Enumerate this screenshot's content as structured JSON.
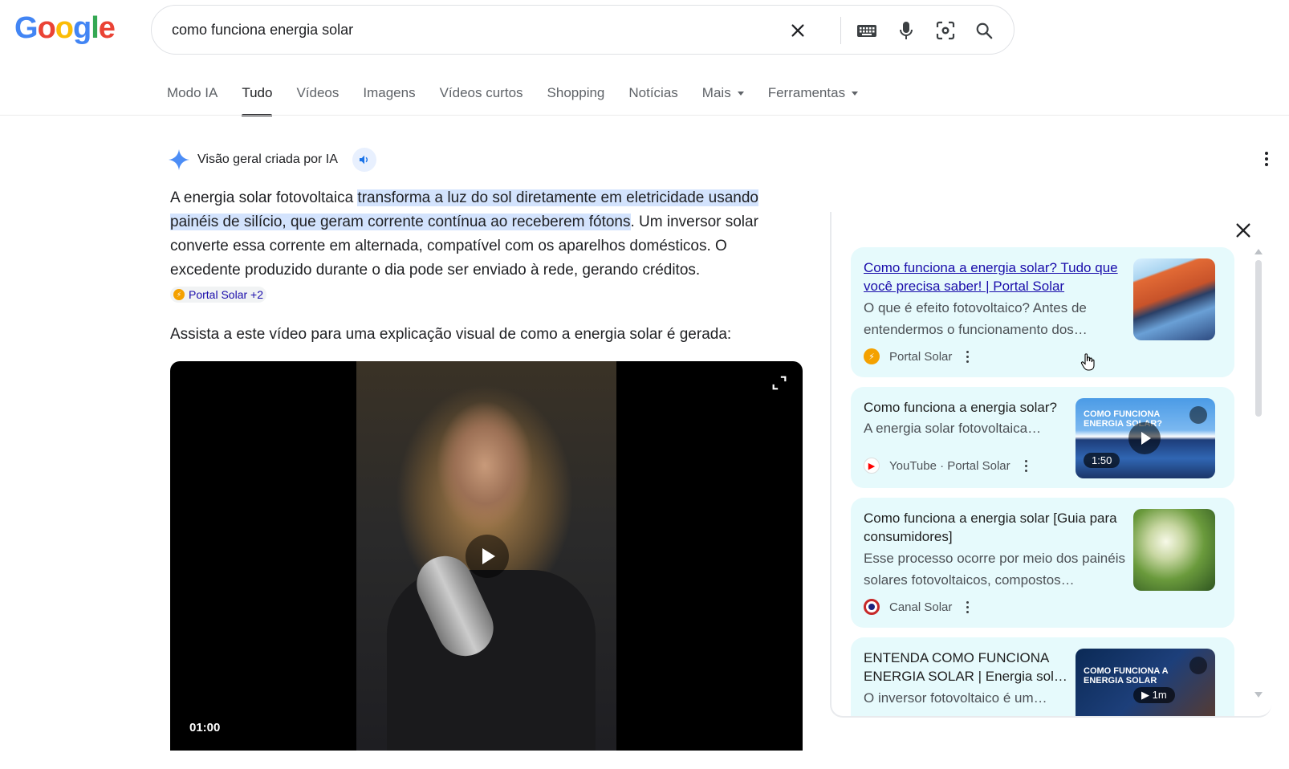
{
  "logo": {
    "letters": [
      "G",
      "o",
      "o",
      "g",
      "l",
      "e"
    ],
    "colors": [
      "#4285F4",
      "#EA4335",
      "#FBBC05",
      "#4285F4",
      "#34A853",
      "#EA4335"
    ]
  },
  "search": {
    "query": "como funciona energia solar",
    "icons": [
      "close-icon",
      "keyboard-icon",
      "microphone-icon",
      "lens-icon",
      "search-icon"
    ]
  },
  "tabs": [
    {
      "label": "Modo IA",
      "active": false
    },
    {
      "label": "Tudo",
      "active": true
    },
    {
      "label": "Vídeos",
      "active": false
    },
    {
      "label": "Imagens",
      "active": false
    },
    {
      "label": "Vídeos curtos",
      "active": false
    },
    {
      "label": "Shopping",
      "active": false
    },
    {
      "label": "Notícias",
      "active": false
    },
    {
      "label": "Mais",
      "active": false,
      "dropdown": true
    },
    {
      "label": "Ferramentas",
      "active": false,
      "dropdown": true
    }
  ],
  "ai_overview": {
    "title": "Visão geral criada por IA",
    "para_start": "A energia solar fotovoltaica ",
    "para_highlight": "transforma a luz do sol diretamente em eletricidade usando painéis de silício, que geram corrente contínua ao receberem fótons",
    "para_end": ". Um inversor solar converte essa corrente em alternada, compatível com os aparelhos domésticos. O excedente produzido durante o dia pode ser enviado à rede, gerando créditos.",
    "citation": "Portal Solar +2",
    "video_intro": "Assista a este vídeo para uma explicação visual de como a energia solar é gerada:",
    "video_time": "01:00"
  },
  "sources": [
    {
      "title": "Como funciona a energia solar? Tudo que você precisa saber! | Portal Solar",
      "description": "O que é efeito fotovoltaico? Antes de entendermos o funcionamento dos…",
      "source": "Portal Solar",
      "icon_color": "#f4a100"
    },
    {
      "title": "Como funciona a energia solar?",
      "description": "A energia solar fotovoltaica…",
      "source": "YouTube · Portal Solar",
      "duration": "1:50",
      "thumb_text": "COMO FUNCIONA ENERGIA SOLAR?",
      "icon_color": "#ff0000"
    },
    {
      "title": "Como funciona a energia solar [Guia para consumidores]",
      "description": "Esse processo ocorre por meio dos painéis solares fotovoltaicos, compostos…",
      "source": "Canal Solar",
      "icon_color": "#c62828"
    },
    {
      "title": "ENTENDA COMO FUNCIONA ENERGIA SOLAR | Energia sol…",
      "description": "O inversor fotovoltaico é um…",
      "duration": "1m",
      "thumb_text": "COMO FUNCIONA A ENERGIA SOLAR"
    }
  ]
}
